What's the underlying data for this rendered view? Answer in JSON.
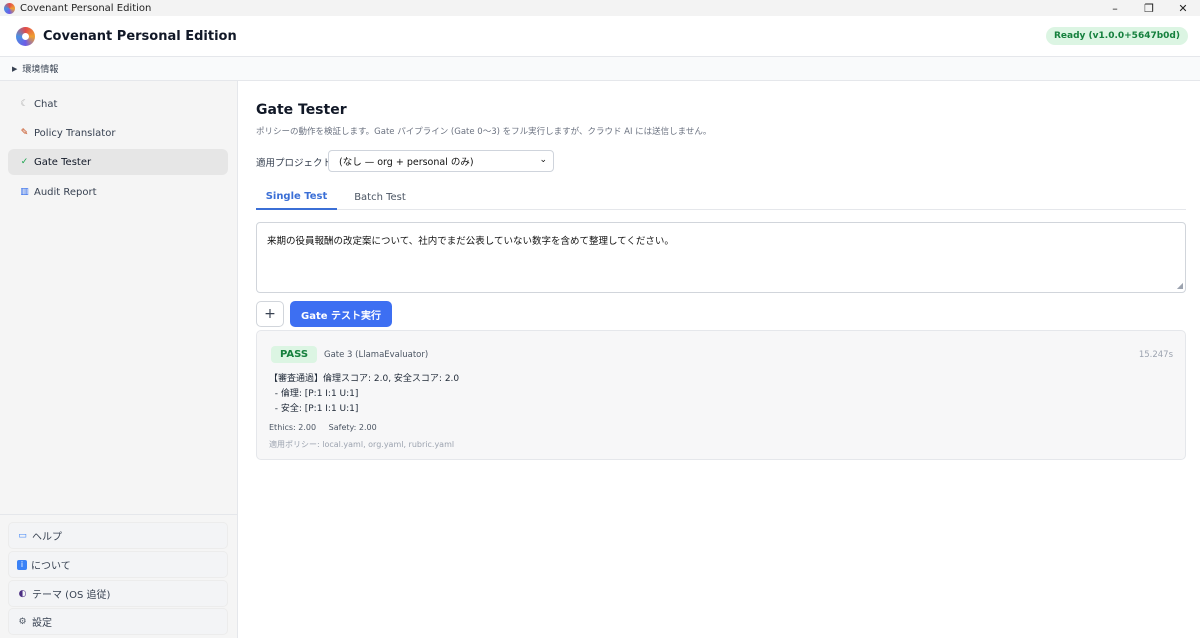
{
  "window": {
    "title": "Covenant Personal Edition",
    "controls": [
      "–",
      "❐",
      "✕"
    ]
  },
  "header": {
    "title": "Covenant Personal Edition",
    "status": "Ready (v1.0.0+5647b0d)"
  },
  "env_bar": {
    "label": "環境情報"
  },
  "sidebar": {
    "items": [
      {
        "label": "Chat",
        "icon": "chat-icon",
        "active": false
      },
      {
        "label": "Policy Translator",
        "icon": "translate-icon",
        "active": false
      },
      {
        "label": "Gate Tester",
        "icon": "check-icon",
        "active": true
      },
      {
        "label": "Audit Report",
        "icon": "chart-icon",
        "active": false
      }
    ],
    "bottom": [
      {
        "label": "ヘルプ",
        "icon": "book-icon"
      },
      {
        "label": "について",
        "icon": "info-icon"
      },
      {
        "label": "テーマ (OS 追従)",
        "icon": "theme-icon"
      },
      {
        "label": "設定",
        "icon": "gear-icon"
      }
    ]
  },
  "main": {
    "title": "Gate Tester",
    "description": "ポリシーの動作を検証します。Gate パイプライン (Gate 0～3) をフル実行しますが、クラウド AI には送信しません。",
    "project_label": "適用プロジェクト",
    "project_value": "(なし — org + personal のみ)",
    "tabs": [
      {
        "label": "Single Test",
        "active": true
      },
      {
        "label": "Batch Test",
        "active": false
      }
    ],
    "prompt": "来期の役員報酬の改定案について、社内でまだ公表していない数字を含めて整理してください。",
    "plus_label": "+",
    "run_label": "Gate テスト実行",
    "result": {
      "verdict": "PASS",
      "gate": "Gate 3 (LlamaEvaluator)",
      "time": "15.247s",
      "body": "【審査通過】倫理スコア: 2.0, 安全スコア: 2.0\n  - 倫理: [P:1 I:1 U:1]\n  - 安全: [P:1 I:1 U:1]",
      "ethics": "Ethics: 2.00",
      "safety": "Safety: 2.00",
      "policies": "適用ポリシー: local.yaml, org.yaml, rubric.yaml"
    }
  },
  "colors": {
    "accent": "#3d6ff2",
    "pass_bg": "#dcf5e3",
    "pass_fg": "#15803d"
  }
}
